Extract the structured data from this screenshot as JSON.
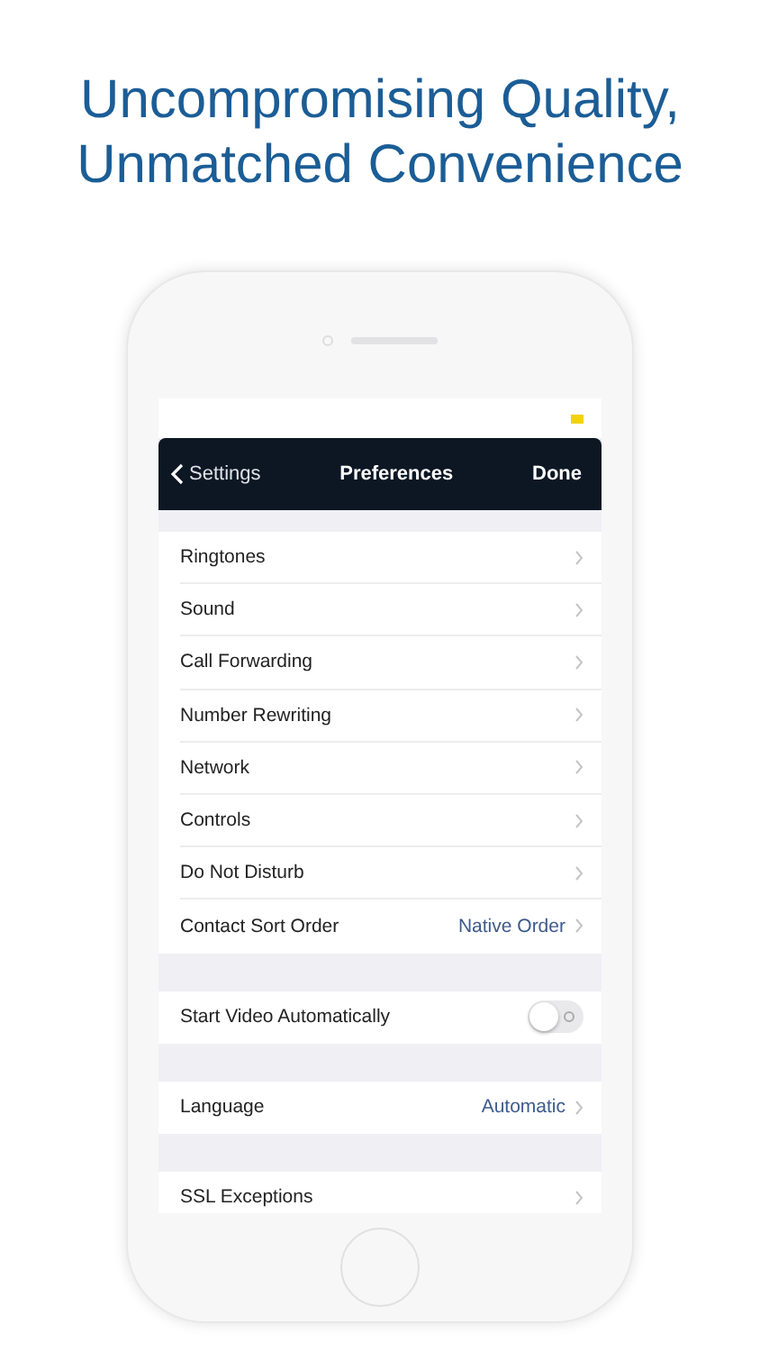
{
  "headline": [
    "Uncompromising Quality,",
    "Unmatched Convenience"
  ],
  "nav_bar": {
    "back": "Settings",
    "title": "Preferences",
    "action": "Done"
  },
  "sections": [
    [
      {
        "kind": "link",
        "label": "Ringtones"
      },
      {
        "kind": "link",
        "label": "Sound"
      },
      {
        "kind": "link",
        "label": "Call Forwarding"
      },
      {
        "kind": "link",
        "label": "Number Rewriting"
      },
      {
        "kind": "link",
        "label": "Network"
      },
      {
        "kind": "link",
        "label": "Controls"
      },
      {
        "kind": "link",
        "label": "Do Not Disturb"
      },
      {
        "kind": "link",
        "label": "Contact Sort Order",
        "value": "Native Order"
      }
    ],
    [
      {
        "kind": "toggle",
        "label": "Start Video Automatically",
        "on": false
      }
    ],
    [
      {
        "kind": "link",
        "label": "Language",
        "value": "Automatic"
      }
    ],
    [
      {
        "kind": "link",
        "label": "SSL Exceptions"
      }
    ]
  ]
}
